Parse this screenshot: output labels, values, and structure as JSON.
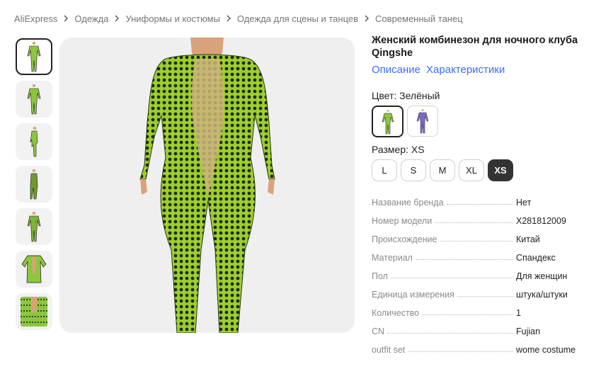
{
  "breadcrumb": [
    "AliExpress",
    "Одежда",
    "Униформы и костюмы",
    "Одежда для сцены и танцев",
    "Современный танец"
  ],
  "product": {
    "title": "Женский комбинезон для ночного клуба Qingshe",
    "tabs": [
      "Описание",
      "Характеристики"
    ]
  },
  "color": {
    "label": "Цвет: Зелёный",
    "options": [
      {
        "icon": "green-jumpsuit-swatch",
        "color": "#8cc63f",
        "selected": true
      },
      {
        "icon": "purple-jumpsuit-swatch",
        "color": "#7b6bb5",
        "selected": false
      }
    ]
  },
  "size": {
    "label": "Размер: XS",
    "options": [
      "L",
      "S",
      "M",
      "XL",
      "XS"
    ],
    "selected": "XS"
  },
  "specs": [
    {
      "key": "Название бренда",
      "value": "Нет"
    },
    {
      "key": "Номер модели",
      "value": "X281812009"
    },
    {
      "key": "Происхождение",
      "value": "Китай"
    },
    {
      "key": "Материал",
      "value": "Спандекс"
    },
    {
      "key": "Пол",
      "value": "Для женщин"
    },
    {
      "key": "Единица измерения",
      "value": "штука/штуки"
    },
    {
      "key": "Количество",
      "value": "1"
    },
    {
      "key": "CN",
      "value": "Fujian"
    },
    {
      "key": "outfit set",
      "value": "wome costume"
    }
  ],
  "gallery": {
    "thumbnail_count": 7,
    "selected_index": 0,
    "accent": "#8cc63f",
    "pattern": "#1a1a1a",
    "skin": "#d9a27a"
  }
}
